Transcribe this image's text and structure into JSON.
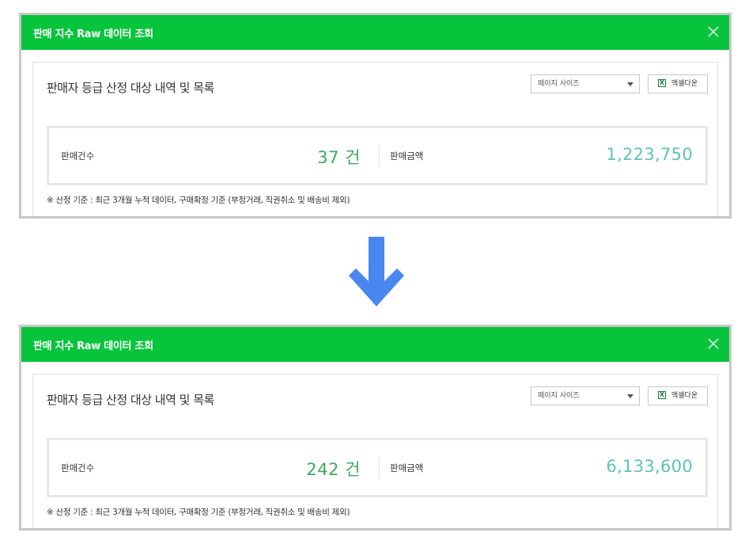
{
  "before": {
    "title": "판매 지수 Raw 데이터 조회",
    "heading": "판매자 등급 산정 대상 내역 및 목록",
    "page_size_label": "페이지 사이즈",
    "excel_label": "엑셀다운",
    "count_label": "판매건수",
    "count_value": "37 건",
    "amount_label": "판매금액",
    "amount_value": "1,223,750",
    "note": "※ 산정 기준 : 최근 3개월 누적 데이터, 구매확정 기준 (부정거래, 직권취소 및 배송비 제외)"
  },
  "after": {
    "title": "판매 지수 Raw 데이터 조회",
    "heading": "판매자 등급 산정 대상 내역 및 목록",
    "page_size_label": "페이지 사이즈",
    "excel_label": "엑셀다운",
    "count_label": "판매건수",
    "count_value": "242 건",
    "amount_label": "판매금액",
    "amount_value": "6,133,600",
    "note": "※ 산정 기준 : 최근 3개월 누적 데이터, 구매확정 기준 (부정거래, 직권취소 및 배송비 제외)"
  },
  "colors": {
    "title_bar": "#08c43c",
    "count_value": "#3fa85c",
    "amount_value": "#5ec2b6",
    "arrow": "#4a86f0"
  },
  "icons": {
    "close": "close-icon",
    "excel": "excel-icon",
    "caret": "chevron-down-icon",
    "arrow": "arrow-down-icon"
  }
}
